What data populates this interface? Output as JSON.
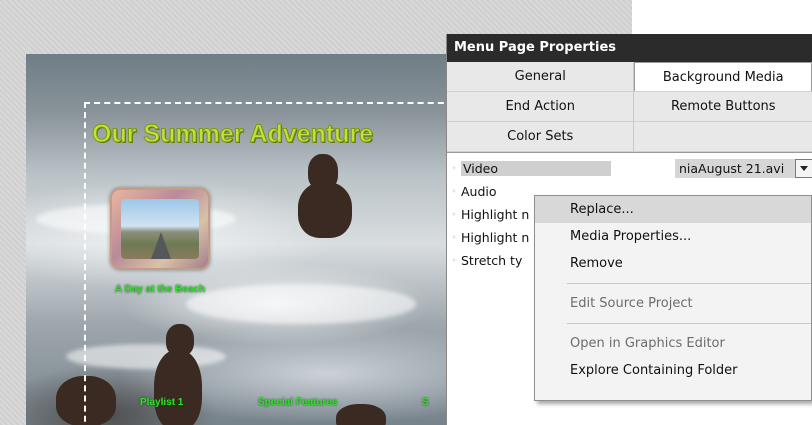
{
  "preview": {
    "title": "Our Summer Adventure",
    "thumbnail_label": "A Day at the Beach",
    "bottom_items": [
      "Playlist 1",
      "Special Features",
      "S"
    ]
  },
  "panel": {
    "title": "Menu Page Properties",
    "tabs": [
      [
        {
          "label": "General"
        },
        {
          "label": "Background Media",
          "active": true
        }
      ],
      [
        {
          "label": "End Action"
        },
        {
          "label": "Remote Buttons"
        }
      ],
      [
        {
          "label": "Color Sets"
        },
        {
          "label": ""
        }
      ]
    ],
    "properties": [
      {
        "name": "Video",
        "value": "niaAugust 21.avi"
      },
      {
        "name": "Audio"
      },
      {
        "name": "Highlight n"
      },
      {
        "name": "Highlight n"
      },
      {
        "name": "Stretch ty"
      }
    ]
  },
  "context_menu": {
    "items": [
      {
        "label": "Replace...",
        "highlight": true
      },
      {
        "label": "Media Properties..."
      },
      {
        "label": "Remove"
      },
      {
        "separator": true
      },
      {
        "label": "Edit Source Project",
        "disabled": true
      },
      {
        "separator": true
      },
      {
        "label": "Open in Graphics Editor",
        "disabled": true
      },
      {
        "label": "Explore Containing Folder"
      }
    ]
  }
}
